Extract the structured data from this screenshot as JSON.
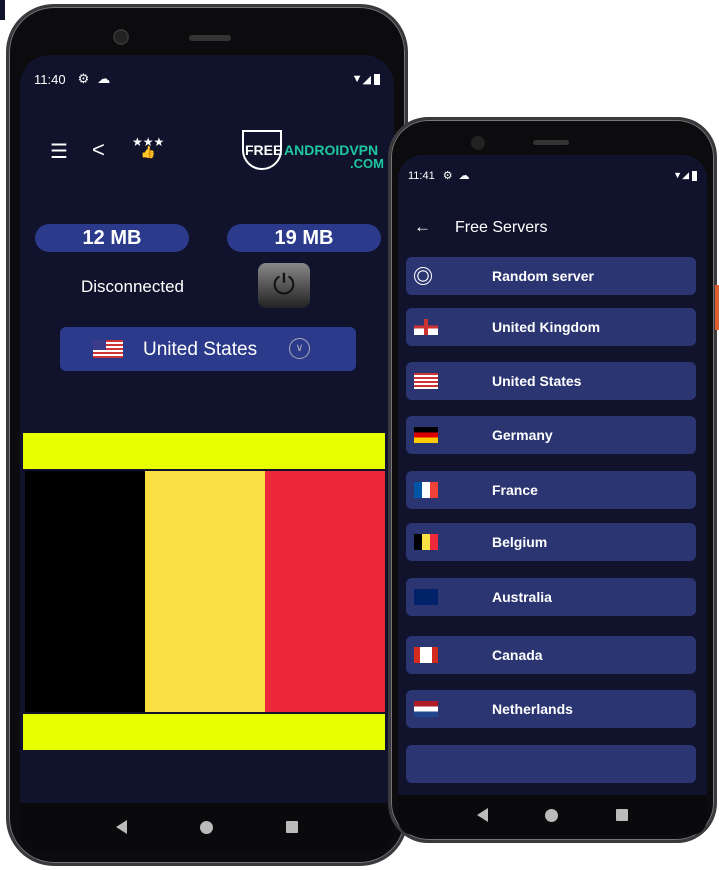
{
  "left_phone": {
    "status": {
      "time": "11:40"
    },
    "toolbar": {
      "menu_icon": "list-icon",
      "share_icon": "share-icon",
      "rate_icon": "thumbs-up-stars-icon"
    },
    "logo": {
      "text_free": "FREE",
      "text_android": "ANDROIDVPN",
      "text_com": ".COM"
    },
    "usage": {
      "download": "12 MB",
      "upload": "19 MB"
    },
    "connection_status": "Disconnected",
    "selected_country": "United States",
    "flag_colors": [
      "#000000",
      "#fae042",
      "#ed2939"
    ],
    "banner_color": "#e8ff00"
  },
  "right_phone": {
    "status": {
      "time": "11:41"
    },
    "title": "Free Servers",
    "servers": [
      {
        "label": "Random server",
        "icon": "globe-icon"
      },
      {
        "label": "United Kingdom",
        "icon": "flag-england"
      },
      {
        "label": "United States",
        "icon": "flag-us"
      },
      {
        "label": "Germany",
        "icon": "flag-de"
      },
      {
        "label": "France",
        "icon": "flag-fr"
      },
      {
        "label": "Belgium",
        "icon": "flag-be"
      },
      {
        "label": "Australia",
        "icon": "flag-au"
      },
      {
        "label": "Canada",
        "icon": "flag-ca"
      },
      {
        "label": "Netherlands",
        "icon": "flag-nl"
      }
    ]
  },
  "colors": {
    "screen_bg": "#10132b",
    "card_bg": "#2a3572",
    "accent_green": "#1fc7a0"
  }
}
